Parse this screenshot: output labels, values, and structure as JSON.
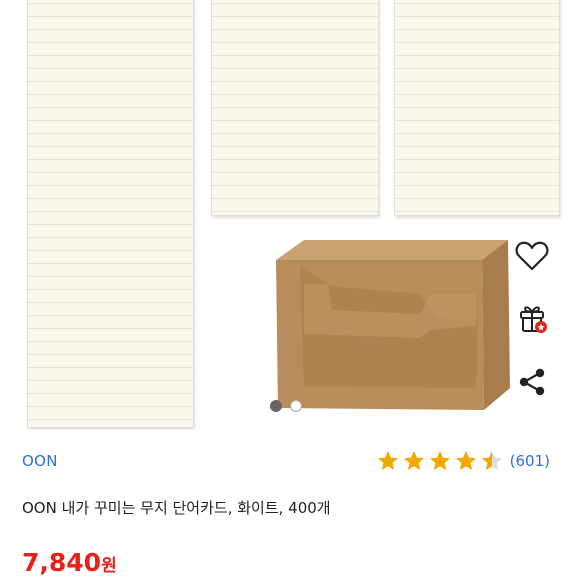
{
  "product": {
    "brand": "OON",
    "rating_value": 4.5,
    "rating_count": "(601)",
    "title": "OON 내가 꾸미는 무지 단어카드, 화이트, 400개",
    "price": "7,840",
    "currency": "원"
  },
  "gallery": {
    "image_count": 2,
    "active_index": 0
  },
  "actions": {
    "wishlist_icon": "heart-outline-icon",
    "gift_icon": "gift-icon",
    "share_icon": "share-icon"
  },
  "colors": {
    "brand_blue": "#2f6fd6",
    "price_red": "#e8201a",
    "star_gold": "#f0a800"
  }
}
